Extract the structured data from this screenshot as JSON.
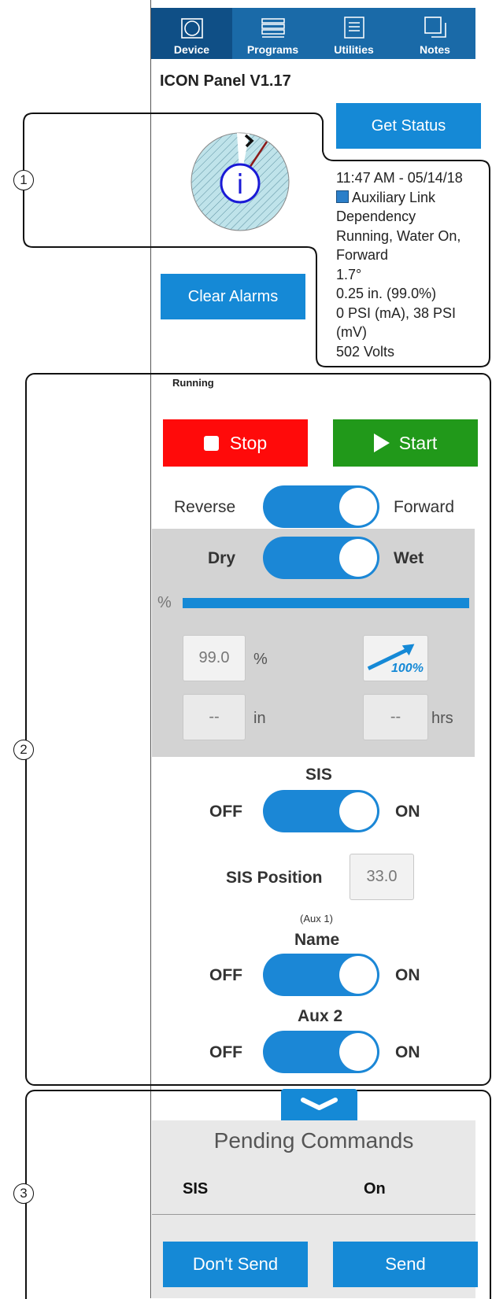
{
  "nav": {
    "items": [
      {
        "label": "Device",
        "icon": "device-icon"
      },
      {
        "label": "Programs",
        "icon": "programs-icon"
      },
      {
        "label": "Utilities",
        "icon": "utilities-icon"
      },
      {
        "label": "Notes",
        "icon": "notes-icon"
      }
    ],
    "active": "Device"
  },
  "header": {
    "title": "ICON Panel V1.17"
  },
  "buttons": {
    "get_status": "Get Status",
    "clear_alarms": "Clear Alarms",
    "stop": "Stop",
    "start": "Start",
    "dont_send": "Don't Send",
    "send": "Send"
  },
  "status": {
    "timestamp": "11:47 AM - 05/14/18",
    "link": "Auxiliary Link",
    "line3": "Dependency",
    "line4": "Running, Water On,",
    "line5": "Forward",
    "angle": "1.7°",
    "depth": "0.25 in. (99.0%)",
    "pressure1": "0 PSI (mA), 38 PSI",
    "pressure2": "(mV)",
    "voltage": "502 Volts"
  },
  "annotations": {
    "one": "1",
    "two": "2",
    "three": "3"
  },
  "state_label": "Running",
  "direction": {
    "left": "Reverse",
    "right": "Forward",
    "on": true
  },
  "wet": {
    "left": "Dry",
    "right": "Wet",
    "on": true
  },
  "percent_symbol": "%",
  "progress_fraction": 1.0,
  "percent_field": {
    "value": "99.0",
    "unit": "%"
  },
  "speed_badge": "100%",
  "depth_field": {
    "value": "--",
    "unit": "in"
  },
  "hours_field": {
    "value": "--",
    "unit": "hrs"
  },
  "sis": {
    "title": "SIS",
    "off": "OFF",
    "on": "ON",
    "enabled": true
  },
  "sis_position": {
    "label": "SIS Position",
    "value": "33.0"
  },
  "aux1": {
    "subtitle": "(Aux 1)",
    "title": "Name",
    "off": "OFF",
    "on": "ON",
    "enabled": true
  },
  "aux2": {
    "title": "Aux 2",
    "off": "OFF",
    "on": "ON",
    "enabled": true
  },
  "pending": {
    "title": "Pending Commands",
    "rows": [
      {
        "name": "SIS",
        "value": "On"
      }
    ]
  },
  "colors": {
    "nav": "#1a6aa8",
    "accent": "#1589d6",
    "stop": "#ff0a0a",
    "start": "#21991a"
  }
}
